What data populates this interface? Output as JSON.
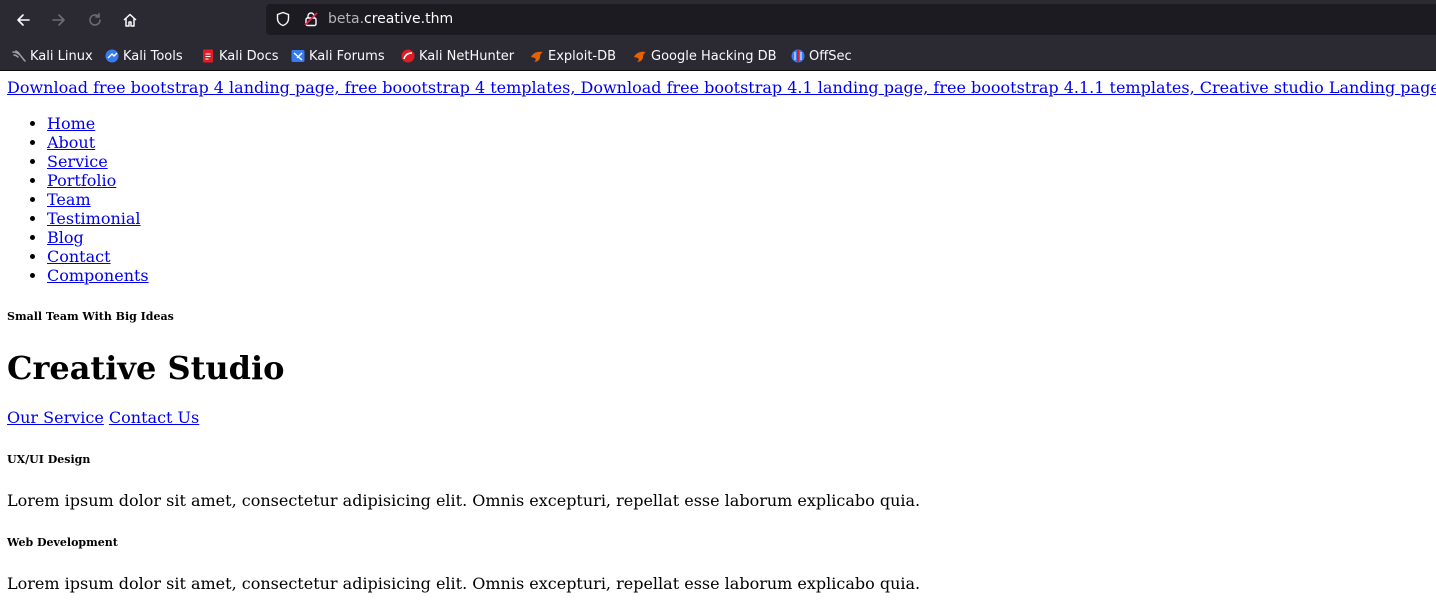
{
  "browser": {
    "url_subdomain": "beta.",
    "url_domain": "creative.thm",
    "bookmarks": [
      {
        "label": "Kali Linux",
        "icon": "kali-dragon-icon",
        "color": "#9e9ea6"
      },
      {
        "label": "Kali Tools",
        "icon": "kali-tools-icon",
        "color": "#367bf0"
      },
      {
        "label": "Kali Docs",
        "icon": "kali-docs-icon",
        "color": "#e01b24"
      },
      {
        "label": "Kali Forums",
        "icon": "kali-forums-icon",
        "color": "#367bf0"
      },
      {
        "label": "Kali NetHunter",
        "icon": "kali-nethunter-icon",
        "color": "#e01b24"
      },
      {
        "label": "Exploit-DB",
        "icon": "exploit-db-icon",
        "color": "#e66100"
      },
      {
        "label": "Google Hacking DB",
        "icon": "ghdb-icon",
        "color": "#e66100"
      },
      {
        "label": "OffSec",
        "icon": "offsec-icon",
        "color": "#367bf0"
      }
    ]
  },
  "page": {
    "top_link": "Download free bootstrap 4 landing page, free boootstrap 4 templates, Download free bootstrap 4.1 landing page, free boootstrap 4.1.1 templates, Creative studio Landing page",
    "menu": [
      "Home",
      "About",
      "Service",
      "Portfolio",
      "Team",
      "Testimonial",
      "Blog",
      "Contact",
      "Components"
    ],
    "hero": {
      "eyebrow": "Small Team With Big Ideas",
      "title": "Creative Studio",
      "primary_link": "Our Service",
      "secondary_link": "Contact Us"
    },
    "features": [
      {
        "title": "UX/UI Design",
        "text": "Lorem ipsum dolor sit amet, consectetur adipisicing elit. Omnis excepturi, repellat esse laborum explicabo quia."
      },
      {
        "title": "Web Development",
        "text": "Lorem ipsum dolor sit amet, consectetur adipisicing elit. Omnis excepturi, repellat esse laborum explicabo quia."
      }
    ]
  }
}
